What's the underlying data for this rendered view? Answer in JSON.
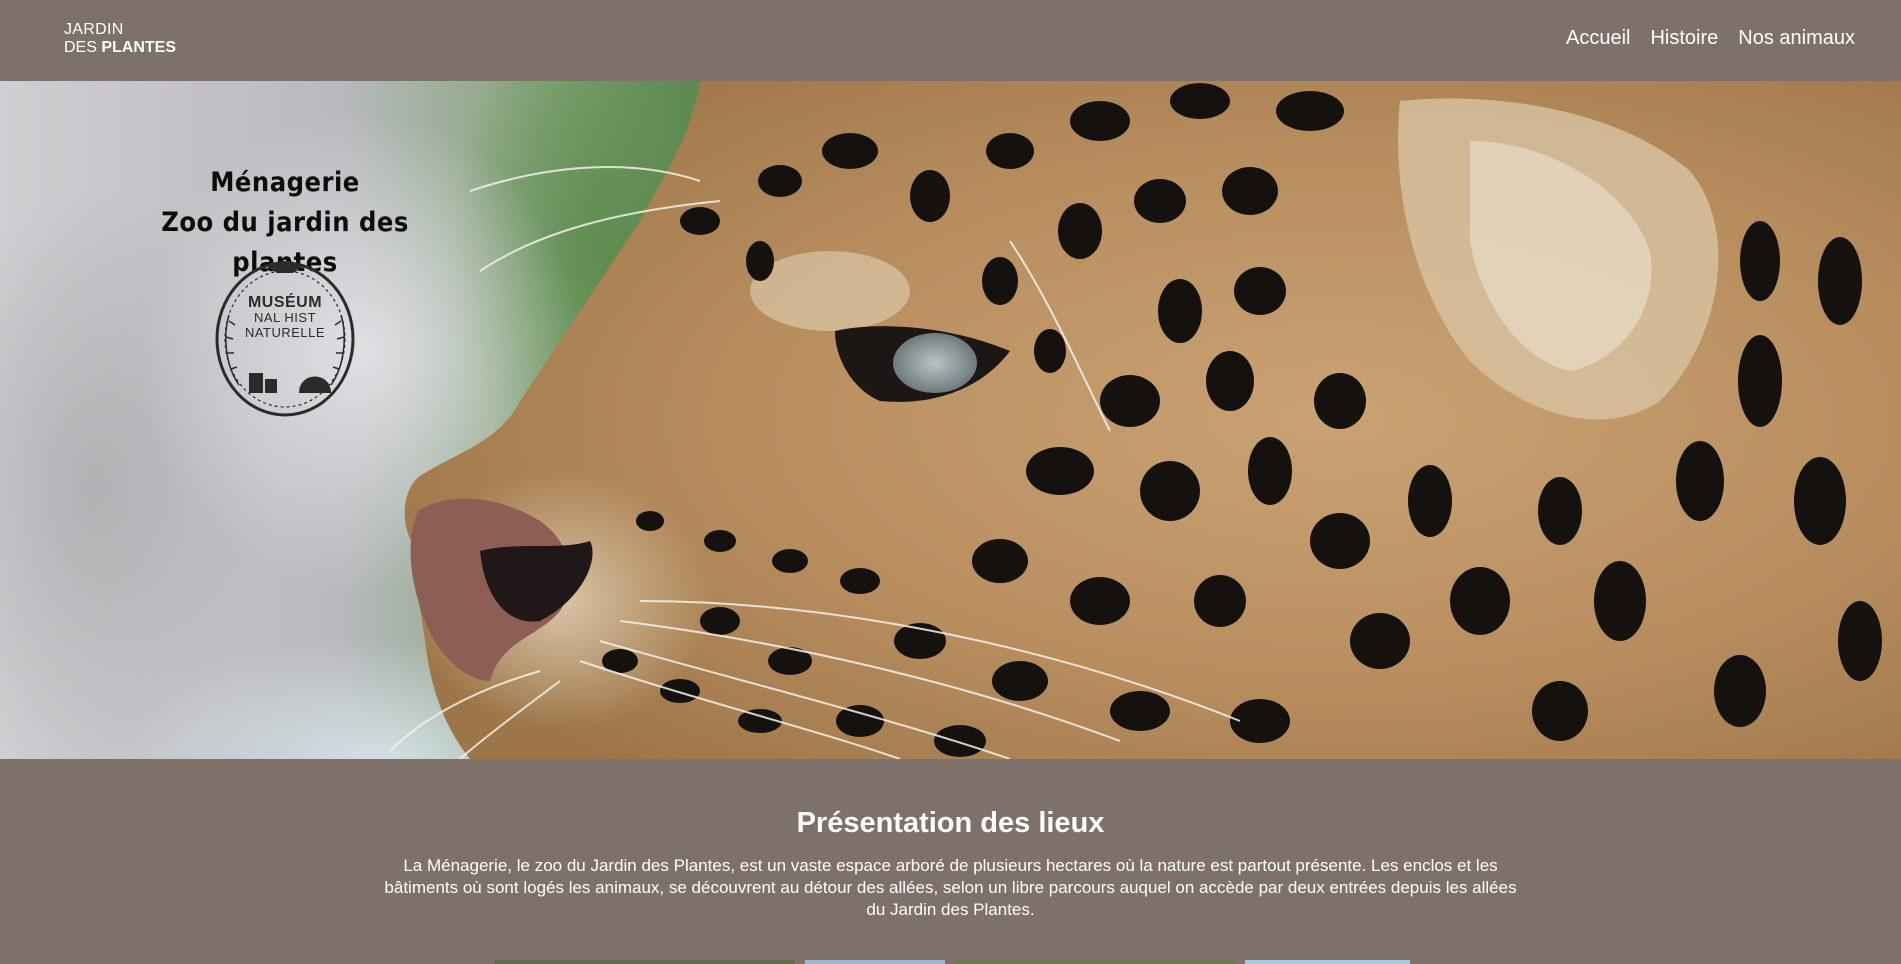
{
  "header": {
    "logo_line1": "JARDIN",
    "logo_line2_prefix": "DES ",
    "logo_line2_bold": "PLANTES",
    "nav": [
      {
        "label": "Accueil"
      },
      {
        "label": "Histoire"
      },
      {
        "label": "Nos animaux"
      }
    ]
  },
  "hero": {
    "title_line1": "Ménagerie",
    "title_line2": "Zoo du jardin des plantes",
    "seal": {
      "line1": "MUSÉUM",
      "line2": "NAL HIST",
      "line3": "NATURELLE"
    }
  },
  "presentation": {
    "heading": "Présentation des lieux",
    "text": "La Ménagerie, le zoo du Jardin des Plantes, est un vaste espace arboré de plusieurs hectares où la nature est partout présente. Les enclos et les bâtiments où sont logés les animaux, se découvrent au détour des allées, selon un libre parcours auquel on accède par deux entrées depuis les allées du Jardin des Plantes."
  },
  "colors": {
    "page_background": "#7e716a",
    "text": "#ffffff",
    "title_text": "#0c0c0c"
  }
}
